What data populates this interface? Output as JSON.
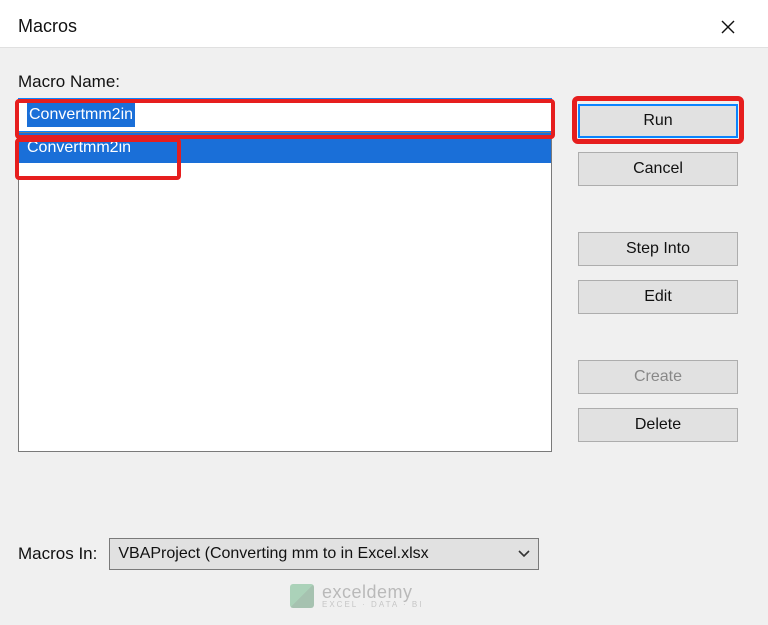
{
  "titlebar": {
    "title": "Macros"
  },
  "labels": {
    "macro_name": "Macro Name:",
    "macros_in": "Macros In:"
  },
  "macro_name_input": {
    "value": "Convertmm2in"
  },
  "macro_list": {
    "items": [
      "Convertmm2in"
    ],
    "selected_index": 0
  },
  "buttons": {
    "run": "Run",
    "cancel": "Cancel",
    "step_into": "Step Into",
    "edit": "Edit",
    "create": "Create",
    "delete": "Delete"
  },
  "macros_in_select": {
    "selected": "VBAProject (Converting mm to in Excel.xlsx"
  },
  "watermark": {
    "brand": "exceldemy",
    "tagline": "EXCEL · DATA · BI"
  }
}
